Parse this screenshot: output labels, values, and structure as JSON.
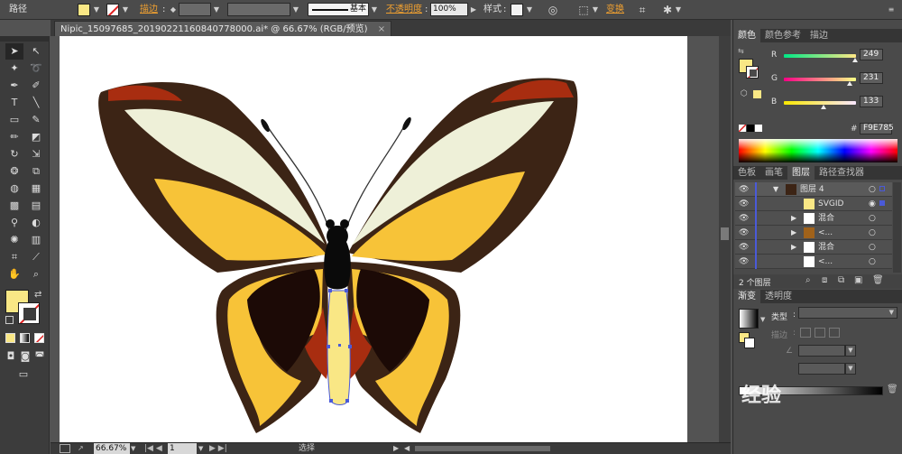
{
  "control_bar": {
    "label": "路径",
    "stroke_label": "描边",
    "stroke_style": "基本",
    "opacity_label": "不透明度",
    "opacity_value": "100%",
    "style_label": "样式",
    "transform_label": "变换",
    "fill_color": "#F9E785"
  },
  "document": {
    "tab_title": "Nipic_15097685_20190221160840778000.ai* @ 66.67% (RGB/预览)",
    "close": "×"
  },
  "color_panel": {
    "tabs": [
      "颜色",
      "颜色参考",
      "描边"
    ],
    "r_label": "R",
    "r_value": "249",
    "g_label": "G",
    "g_value": "231",
    "b_label": "B",
    "b_value": "133",
    "hex_label": "#",
    "hex_value": "F9E785"
  },
  "layers_panel": {
    "tabs": [
      "色板",
      "画笔",
      "图层",
      "路径查找器"
    ],
    "rows": [
      {
        "name": "图层 4"
      },
      {
        "name": "SVGID"
      },
      {
        "name": "混合"
      },
      {
        "name": "<..."
      },
      {
        "name": "混合"
      },
      {
        "name": "<..."
      }
    ],
    "count": "2 个图层"
  },
  "gradient_panel": {
    "tabs": [
      "渐变",
      "透明度"
    ],
    "type_label": "类型",
    "stroke_label": "描边"
  },
  "status_bar": {
    "zoom": "66.67%",
    "page": "1",
    "tool": "选择"
  },
  "watermark": {
    "text": "经验"
  }
}
